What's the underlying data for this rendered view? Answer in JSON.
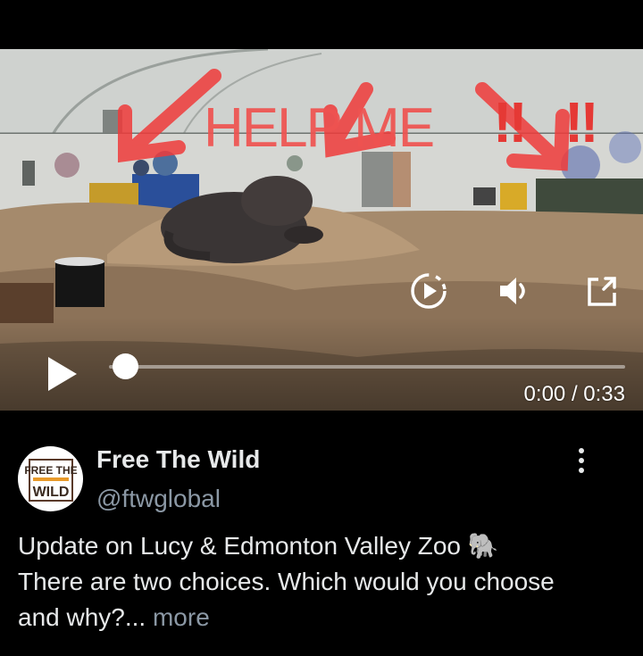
{
  "video": {
    "overlay_text": "HELP ME",
    "exclamations": [
      "‼",
      "‼"
    ],
    "current_time": "0:00",
    "duration": "0:33",
    "time_separator": "/",
    "progress_fraction": 0.0,
    "icons": {
      "play": "play-icon",
      "replay": "replay-icon",
      "volume": "volume-icon",
      "fullscreen": "expand-icon"
    }
  },
  "post": {
    "avatar_text_top": "FREE THE",
    "avatar_text_bottom": "WILD",
    "display_name": "Free The Wild",
    "handle": "@ftwglobal",
    "text_line1": "Update on Lucy & Edmonton Valley Zoo 🐘",
    "text_line2": "There are two choices. Which would you choose",
    "text_line3": "and why?...",
    "more_label": "more",
    "menu_icon": "more-vertical-icon"
  },
  "colors": {
    "background": "#000000",
    "text_primary": "#e7e9ea",
    "text_secondary": "#8b98a5",
    "overlay_red": "#ef5350"
  }
}
